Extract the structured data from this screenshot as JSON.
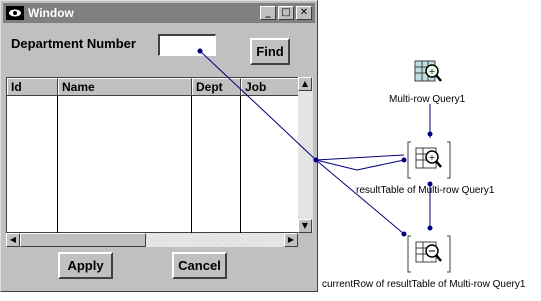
{
  "window": {
    "title": "Window",
    "minimize_label": "_",
    "maximize_label": "□",
    "close_label": "✕"
  },
  "form": {
    "dept_label": "Department Number",
    "dept_value": "",
    "find_label": "Find",
    "apply_label": "Apply",
    "cancel_label": "Cancel"
  },
  "table": {
    "columns": [
      "Id",
      "Name",
      "Dept",
      "Job"
    ]
  },
  "components": [
    {
      "label": "Multi-row Query1",
      "icon": "query-icon"
    },
    {
      "label": "resultTable of Multi-row Query1",
      "icon": "result-table-icon"
    },
    {
      "label": "currentRow of resultTable of Multi-row Query1",
      "icon": "current-row-icon"
    }
  ],
  "colors": {
    "connection_line": "#00007f",
    "window_bg": "#c0c0c0",
    "titlebar_bg": "#808080"
  }
}
